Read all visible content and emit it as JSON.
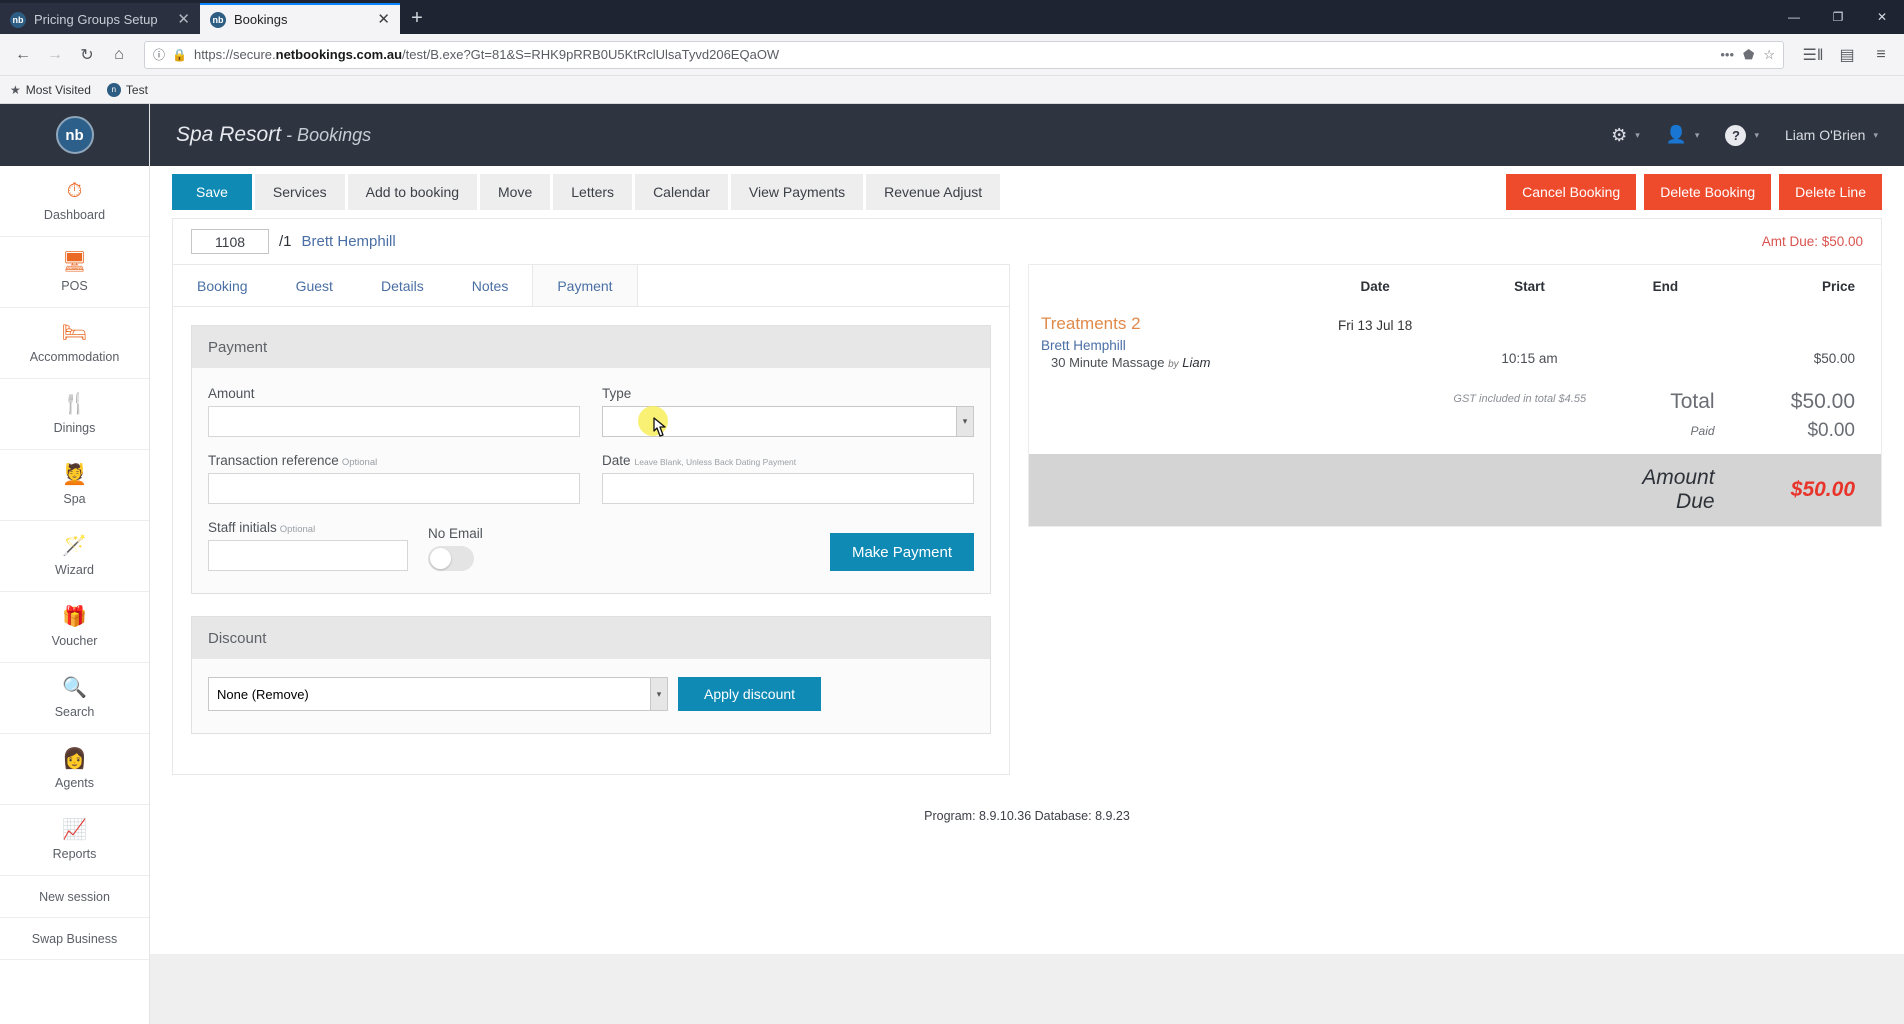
{
  "browser": {
    "tabs": [
      {
        "title": "Pricing Groups Setup",
        "favicon": "nb",
        "close": "✕",
        "active": false
      },
      {
        "title": "Bookings",
        "favicon": "nb",
        "close": "✕",
        "active": true
      }
    ],
    "new_tab_label": "+",
    "window_controls": {
      "minimize": "—",
      "maximize": "❐",
      "close": "✕"
    },
    "nav": {
      "back": "←",
      "forward": "→",
      "reload": "↻",
      "home": "⌂",
      "info_icon": "ⓘ",
      "lock_icon": "🔒",
      "url_prefix": "https://secure.",
      "url_domain": "netbookings.com.au",
      "url_suffix": "/test/B.exe?Gt=81&S=RHK9pRRB0U5KtRclUlsaTyvd206EQaOW",
      "menu_dots": "•••",
      "pocket": "⬟",
      "bookmark_star": "☆",
      "library": "☰‖",
      "sidebar_toggle": "▤",
      "hamburger": "≡"
    },
    "bookmarks": [
      {
        "label": "Most Visited",
        "icon": "star-icon"
      },
      {
        "label": "Test",
        "icon": "nb-icon"
      }
    ]
  },
  "sidebar": {
    "logo": "nb",
    "items": [
      {
        "label": "Dashboard",
        "icon": "⏱"
      },
      {
        "label": "POS",
        "icon": "🖥"
      },
      {
        "label": "Accommodation",
        "icon": "🛏"
      },
      {
        "label": "Dinings",
        "icon": "🍴"
      },
      {
        "label": "Spa",
        "icon": "💆"
      },
      {
        "label": "Wizard",
        "icon": "🪄"
      },
      {
        "label": "Voucher",
        "icon": "🎁"
      },
      {
        "label": "Search",
        "icon": "🔍"
      },
      {
        "label": "Agents",
        "icon": "👩"
      },
      {
        "label": "Reports",
        "icon": "📈"
      }
    ],
    "plain_items": [
      {
        "label": "New session"
      },
      {
        "label": "Swap Business"
      }
    ]
  },
  "topbar": {
    "business": "Spa Resort",
    "section": " - Bookings",
    "gear_icon": "⚙",
    "user_icon": "👤",
    "help_icon": "?",
    "caret": "▾",
    "username": "Liam O'Brien"
  },
  "toolbar": {
    "left_buttons": [
      {
        "label": "Save",
        "style": "primary"
      },
      {
        "label": "Services",
        "style": "gray"
      },
      {
        "label": "Add to booking",
        "style": "gray"
      },
      {
        "label": "Move",
        "style": "gray"
      },
      {
        "label": "Letters",
        "style": "gray"
      },
      {
        "label": "Calendar",
        "style": "gray"
      },
      {
        "label": "View Payments",
        "style": "gray"
      },
      {
        "label": "Revenue Adjust",
        "style": "gray"
      }
    ],
    "right_buttons": [
      {
        "label": "Cancel Booking"
      },
      {
        "label": "Delete Booking"
      },
      {
        "label": "Delete Line"
      }
    ]
  },
  "booking_bar": {
    "booking_number": "1108",
    "line_suffix": "/1",
    "guest_name": "Brett Hemphill",
    "amount_due_label": "Amt Due: $50.00"
  },
  "tabs": [
    {
      "label": "Booking",
      "active": false
    },
    {
      "label": "Guest",
      "active": false
    },
    {
      "label": "Details",
      "active": false
    },
    {
      "label": "Notes",
      "active": false
    },
    {
      "label": "Payment",
      "active": true
    }
  ],
  "payment_panel": {
    "title": "Payment",
    "amount": {
      "label": "Amount",
      "value": "",
      "placeholder": ""
    },
    "type": {
      "label": "Type",
      "value": "",
      "options": [
        ""
      ]
    },
    "transaction_reference": {
      "label": "Transaction reference",
      "optional": "Optional",
      "value": "",
      "placeholder": ""
    },
    "date": {
      "label": "Date",
      "hint": "Leave Blank, Unless Back Dating Payment",
      "value": "",
      "placeholder": ""
    },
    "staff_initials": {
      "label": "Staff initials",
      "optional": "Optional",
      "value": "",
      "placeholder": ""
    },
    "no_email": {
      "label": "No Email",
      "checked": false
    },
    "make_payment_button": "Make Payment"
  },
  "discount_panel": {
    "title": "Discount",
    "select_value": "None (Remove)",
    "apply_button": "Apply discount"
  },
  "summary": {
    "columns": {
      "name": "",
      "date": "Date",
      "start": "Start",
      "end": "End",
      "price": "Price"
    },
    "group": {
      "name": "Treatments 2",
      "date": "Fri 13 Jul 18"
    },
    "lines": [
      {
        "guest": "Brett Hemphill",
        "service": "30 Minute Massage",
        "by_word": "by",
        "staff": "Liam",
        "start": "10:15 am",
        "end": "",
        "price": "$50.00"
      }
    ],
    "gst_note": "GST included in total $4.55",
    "total_label": "Total",
    "total_value": "$50.00",
    "paid_label": "Paid",
    "paid_value": "$0.00",
    "due_label": "Amount Due",
    "due_value": "$50.00"
  },
  "footer": {
    "version_text": "Program: 8.9.10.36 Database: 8.9.23"
  },
  "colors": {
    "brand_orange": "#ea6a25",
    "accent_teal": "#0e8ab5",
    "danger_red": "#ee4b2d",
    "dark_navy": "#2e3440",
    "link_blue": "#4a6fa5"
  }
}
